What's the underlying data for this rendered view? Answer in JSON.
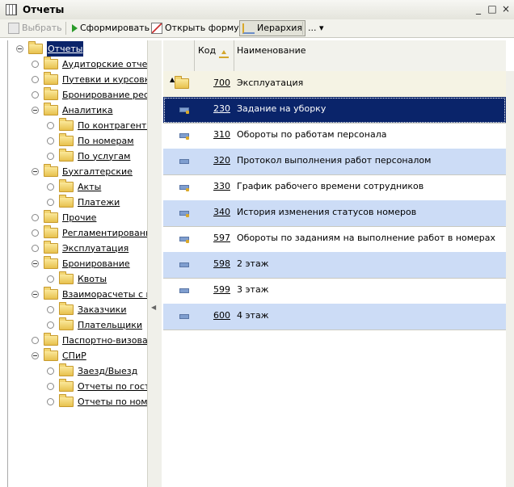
{
  "window": {
    "title": "Отчеты",
    "minimize": "_",
    "maximize": "□",
    "close": "×"
  },
  "toolbar": {
    "select_label": "Выбрать",
    "build_label": "Сформировать",
    "open_form_label": "Открыть форму",
    "hierarchy_label": "Иерархия",
    "more_label": "... ▾"
  },
  "tree": {
    "items": [
      {
        "label": "Отчеты",
        "level": 0,
        "expanded": true,
        "selected": true
      },
      {
        "label": "Аудиторские отчеты",
        "level": 1
      },
      {
        "label": "Путевки и курсовки",
        "level": 1
      },
      {
        "label": "Бронирование ресур",
        "level": 1
      },
      {
        "label": "Аналитика",
        "level": 1,
        "expanded": true
      },
      {
        "label": "По контрагентам",
        "level": 2
      },
      {
        "label": "По номерам",
        "level": 2
      },
      {
        "label": "По услугам",
        "level": 2
      },
      {
        "label": "Бухгалтерские",
        "level": 1,
        "expanded": true
      },
      {
        "label": "Акты",
        "level": 2
      },
      {
        "label": "Платежи",
        "level": 2
      },
      {
        "label": "Прочие",
        "level": 1
      },
      {
        "label": "Регламентированны",
        "level": 1
      },
      {
        "label": "Эксплуатация",
        "level": 1
      },
      {
        "label": "Бронирование",
        "level": 1,
        "expanded": true
      },
      {
        "label": "Квоты",
        "level": 2
      },
      {
        "label": "Взаиморасчеты с ко",
        "level": 1,
        "expanded": true
      },
      {
        "label": "Заказчики",
        "level": 2
      },
      {
        "label": "Плательщики",
        "level": 2
      },
      {
        "label": "Паспортно-визовая с",
        "level": 1
      },
      {
        "label": "СПиР",
        "level": 1,
        "expanded": true
      },
      {
        "label": "Заезд/Выезд",
        "level": 2
      },
      {
        "label": "Отчеты по гостям",
        "level": 2
      },
      {
        "label": "Отчеты по номер",
        "level": 2
      }
    ]
  },
  "grid": {
    "col_code": "Код",
    "col_name": "Наименование",
    "rows": [
      {
        "code": "700",
        "name": "Эксплуатация",
        "kind": "up"
      },
      {
        "code": "230",
        "name": "Задание на уборку",
        "kind": "sel"
      },
      {
        "code": "310",
        "name": "Обороты по работам персонала",
        "kind": "plain"
      },
      {
        "code": "320",
        "name": "Протокол выполнения работ персоналом",
        "kind": "alt"
      },
      {
        "code": "330",
        "name": "График рабочего времени сотрудников",
        "kind": "plain"
      },
      {
        "code": "340",
        "name": "История изменения статусов номеров",
        "kind": "alt"
      },
      {
        "code": "597",
        "name": "Обороты по заданиям на выполнение работ в номерах",
        "kind": "plain"
      },
      {
        "code": "598",
        "name": "2 этаж",
        "kind": "alt"
      },
      {
        "code": "599",
        "name": "3 этаж",
        "kind": "plain"
      },
      {
        "code": "600",
        "name": "4 этаж",
        "kind": "alt"
      }
    ]
  }
}
